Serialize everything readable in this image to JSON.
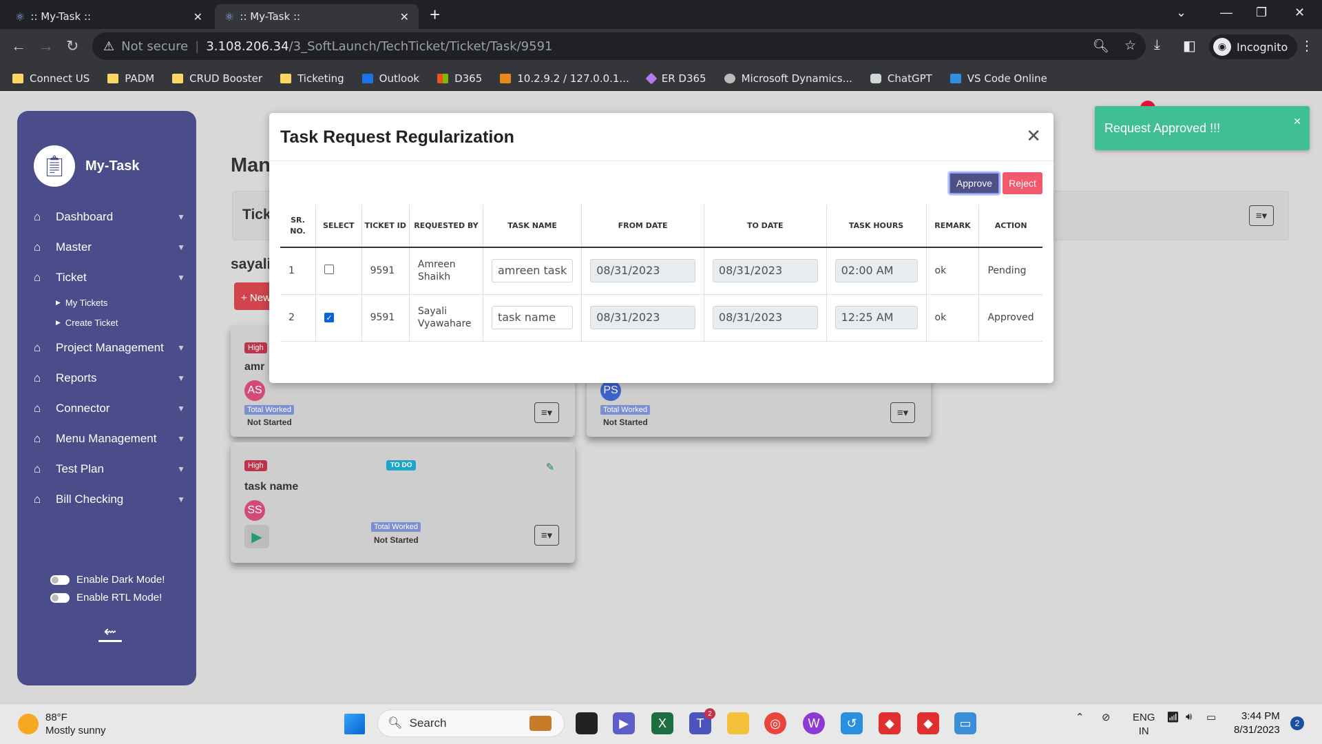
{
  "browser": {
    "tabs": [
      {
        "title": ":: My-Task ::",
        "active": false
      },
      {
        "title": ":: My-Task ::",
        "active": true
      }
    ],
    "not_secure": "Not secure",
    "url_host": "3.108.206.34",
    "url_path": "/3_SoftLaunch/TechTicket/Ticket/Task/9591",
    "profile": "Incognito",
    "bookmarks": [
      "Connect US",
      "PADM",
      "CRUD Booster",
      "Ticketing",
      "Outlook",
      "D365",
      "10.2.9.2 / 127.0.0.1...",
      "ER D365",
      "Microsoft Dynamics...",
      "ChatGPT",
      "VS Code Online"
    ]
  },
  "sidebar": {
    "app_name": "My-Task",
    "items": [
      {
        "label": "Dashboard"
      },
      {
        "label": "Master"
      },
      {
        "label": "Ticket",
        "children": [
          "My Tickets",
          "Create Ticket"
        ]
      },
      {
        "label": "Project Management"
      },
      {
        "label": "Reports"
      },
      {
        "label": "Connector"
      },
      {
        "label": "Menu Management"
      },
      {
        "label": "Test Plan"
      },
      {
        "label": "Bill Checking"
      }
    ],
    "dark_mode": "Enable Dark Mode!",
    "rtl_mode": "Enable RTL Mode!"
  },
  "main": {
    "page_title_partial": "Man",
    "ticket_label_partial": "Tick",
    "user_partial": "sayali",
    "new_button_partial": "+ New",
    "cards": [
      {
        "priority": "High",
        "title_partial": "amr",
        "avatar": "AS",
        "worked": "Total Worked",
        "status": "Not Started"
      },
      {
        "avatar_partial": "PS",
        "worked": "Total Worked",
        "status": "Not Started"
      },
      {
        "priority": "High",
        "todo": "TO DO",
        "title": "task name",
        "avatar": "SS",
        "worked": "Total Worked",
        "status": "Not Started"
      }
    ]
  },
  "modal": {
    "title": "Task Request Regularization",
    "approve": "Approve",
    "reject": "Reject",
    "columns": [
      "SR. NO.",
      "SELECT",
      "TICKET ID",
      "REQUESTED BY",
      "TASK NAME",
      "FROM DATE",
      "TO DATE",
      "TASK HOURS",
      "REMARK",
      "ACTION"
    ],
    "rows": [
      {
        "sr": "1",
        "selected": false,
        "ticket": "9591",
        "requested_by": "Amreen Shaikh",
        "task": "amreen task",
        "from": "08/31/2023",
        "to": "08/31/2023",
        "hours": "02:00 AM",
        "remark": "ok",
        "action": "Pending"
      },
      {
        "sr": "2",
        "selected": true,
        "ticket": "9591",
        "requested_by": "Sayali Vyawahare",
        "task": "task name",
        "from": "08/31/2023",
        "to": "08/31/2023",
        "hours": "12:25 AM",
        "remark": "ok",
        "action": "Approved"
      }
    ]
  },
  "toast": {
    "message": "Request Approved !!!"
  },
  "taskbar": {
    "temp": "88°F",
    "weather": "Mostly sunny",
    "search": "Search",
    "teams_badge": "2",
    "lang1": "ENG",
    "lang2": "IN",
    "time": "3:44 PM",
    "date": "8/31/2023",
    "notifications": "2"
  },
  "colors": {
    "sidebar": "#4b4c8a",
    "approve": "#4d4f86",
    "reject": "#f25a6c",
    "toast": "#3fbf93",
    "high": "#c0344b"
  }
}
